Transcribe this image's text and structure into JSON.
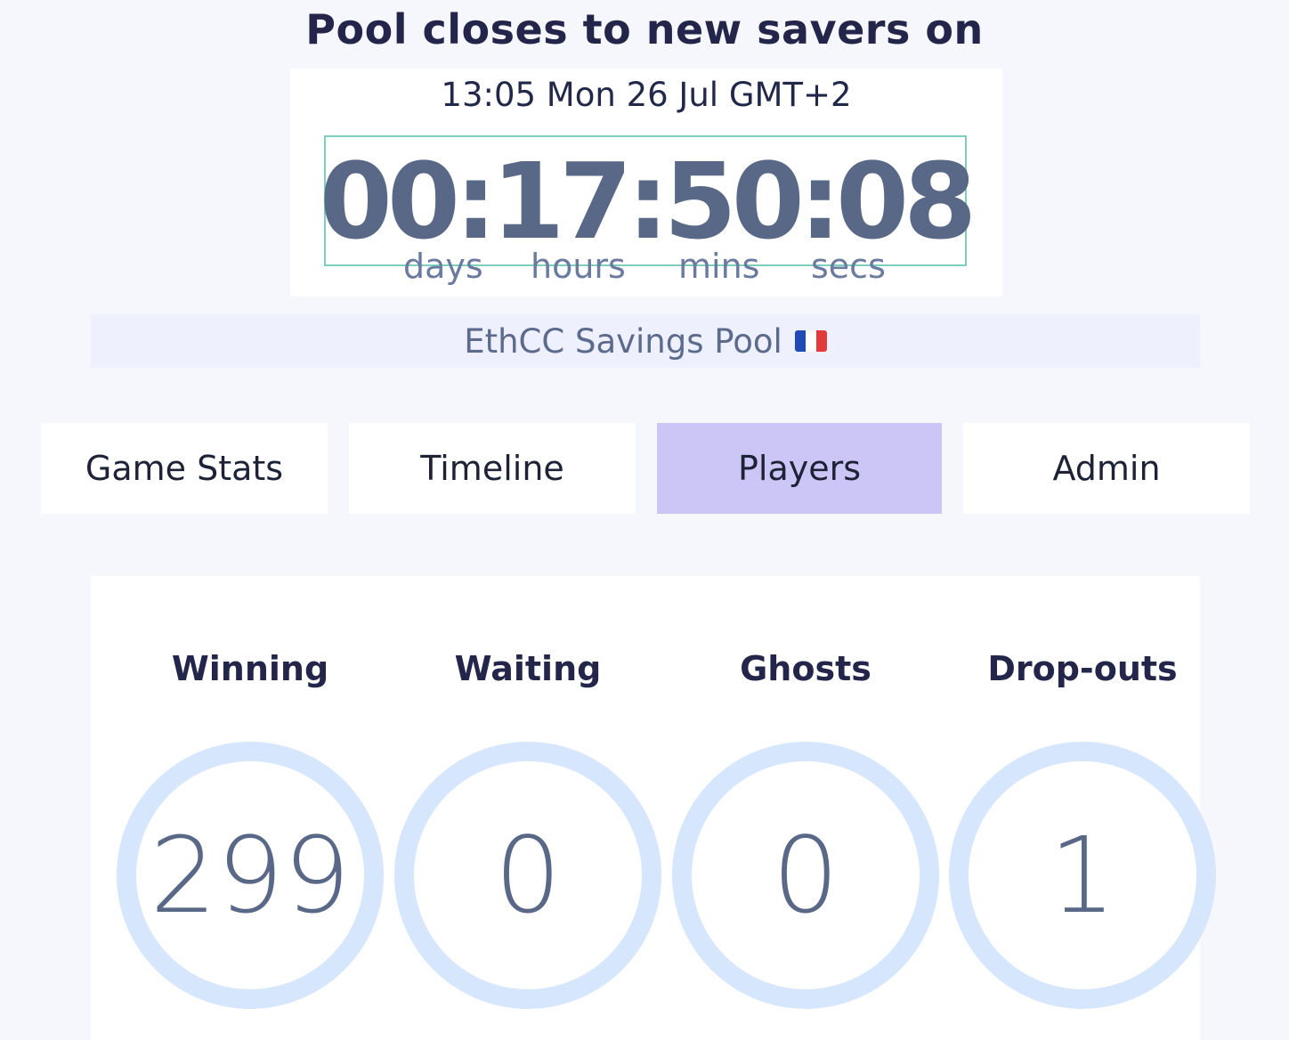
{
  "header": {
    "title": "Pool closes to new savers on",
    "close_date": "13:05 Mon 26 Jul GMT+2"
  },
  "countdown": {
    "display": "00:17:50:08",
    "labels": {
      "days": "days",
      "hours": "hours",
      "mins": "mins",
      "secs": "secs"
    }
  },
  "pool": {
    "name": "EthCC Savings Pool",
    "flag_icon": "france-flag-icon"
  },
  "tabs": [
    {
      "label": "Game Stats",
      "active": false
    },
    {
      "label": "Timeline",
      "active": false
    },
    {
      "label": "Players",
      "active": true
    },
    {
      "label": "Admin",
      "active": false
    }
  ],
  "stats": [
    {
      "label": "Winning",
      "value": "299"
    },
    {
      "label": "Waiting",
      "value": "0"
    },
    {
      "label": "Ghosts",
      "value": "0"
    },
    {
      "label": "Drop-outs",
      "value": "1"
    }
  ],
  "colors": {
    "accent_tab": "#cbc6f5",
    "timer_text": "#596887",
    "ring": "#d6e6fc",
    "timer_border": "#7fcdbf"
  }
}
